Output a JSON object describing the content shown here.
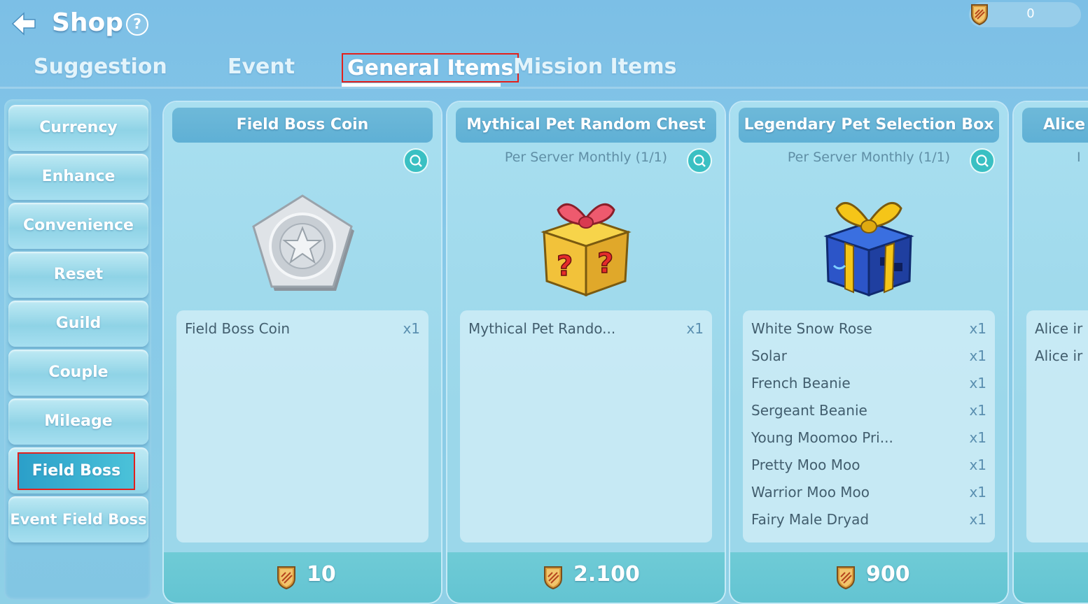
{
  "header": {
    "title": "Shop",
    "help_label": "?",
    "currency_value": "0"
  },
  "tabs": [
    {
      "label": "Suggestion",
      "active": false
    },
    {
      "label": "Event",
      "active": false
    },
    {
      "label": "General Items",
      "active": true
    },
    {
      "label": "Mission Items",
      "active": false
    }
  ],
  "sidebar": {
    "items": [
      {
        "label": "Currency"
      },
      {
        "label": "Enhance"
      },
      {
        "label": "Convenience"
      },
      {
        "label": "Reset"
      },
      {
        "label": "Guild"
      },
      {
        "label": "Couple"
      },
      {
        "label": "Mileage"
      },
      {
        "label": "Field Boss",
        "active": true
      },
      {
        "label": "Event Field Boss"
      }
    ]
  },
  "cards": [
    {
      "title": "Field Boss Coin",
      "limit": "",
      "image_icon": "silver-coin-icon",
      "items": [
        {
          "name": "Field Boss Coin",
          "qty": "x1"
        }
      ],
      "price": "10"
    },
    {
      "title": "Mythical Pet Random Chest",
      "limit": "Per Server Monthly (1/1)",
      "image_icon": "mystery-gift-box-icon",
      "items": [
        {
          "name": "Mythical Pet Rando...",
          "qty": "x1"
        }
      ],
      "price": "2.100"
    },
    {
      "title": "Legendary Pet Selection Box",
      "limit": "Per Server Monthly (1/1)",
      "image_icon": "blue-gift-box-icon",
      "items": [
        {
          "name": "White Snow Rose",
          "qty": "x1"
        },
        {
          "name": "Solar",
          "qty": "x1"
        },
        {
          "name": "French Beanie",
          "qty": "x1"
        },
        {
          "name": "Sergeant Beanie",
          "qty": "x1"
        },
        {
          "name": "Young Moomoo Pri...",
          "qty": "x1"
        },
        {
          "name": "Pretty Moo Moo",
          "qty": "x1"
        },
        {
          "name": "Warrior Moo Moo",
          "qty": "x1"
        },
        {
          "name": "Fairy Male Dryad",
          "qty": "x1"
        }
      ],
      "price": "900"
    },
    {
      "title": "Alice",
      "limit": "I",
      "items": [
        {
          "name": "Alice ir"
        },
        {
          "name": "Alice ir"
        }
      ]
    }
  ],
  "colors": {
    "highlight": "#e3201c",
    "accent": "#3ac0c3"
  }
}
